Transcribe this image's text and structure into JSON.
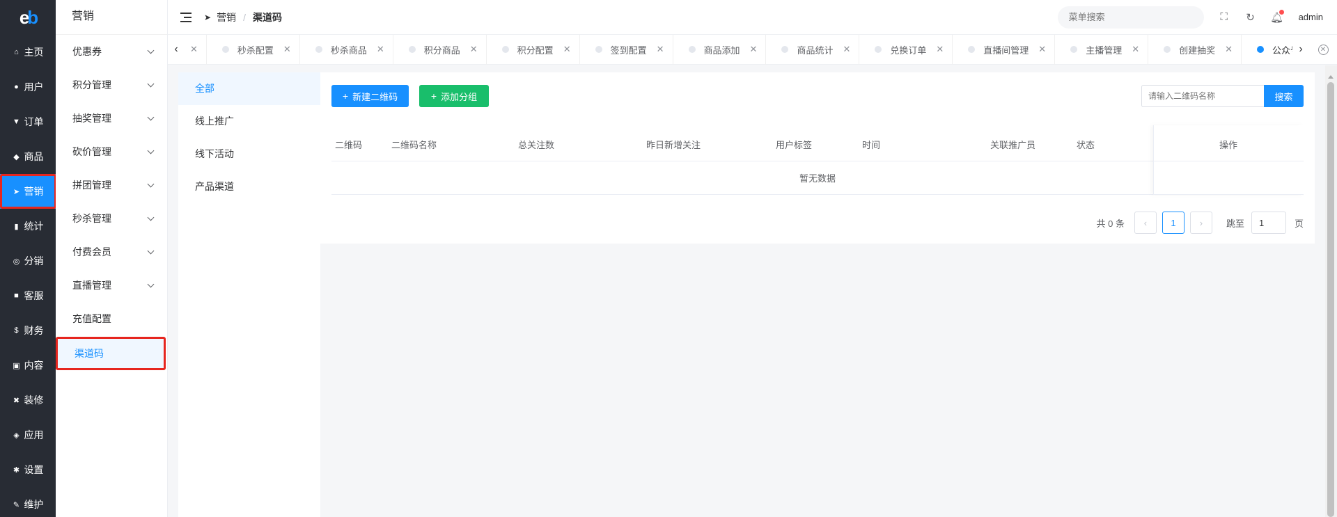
{
  "rail": {
    "logo_e": "e",
    "logo_b": "b",
    "items": [
      {
        "icon": "⌂",
        "label": "主页",
        "icon_name": "home-icon"
      },
      {
        "icon": "●",
        "label": "用户",
        "icon_name": "user-icon"
      },
      {
        "icon": "▼",
        "label": "订单",
        "icon_name": "cart-icon"
      },
      {
        "icon": "◆",
        "label": "商品",
        "icon_name": "basket-icon"
      },
      {
        "icon": "➤",
        "label": "营销",
        "icon_name": "send-icon"
      },
      {
        "icon": "▮",
        "label": "统计",
        "icon_name": "bar-chart-icon"
      },
      {
        "icon": "◎",
        "label": "分销",
        "icon_name": "handshake-icon"
      },
      {
        "icon": "■",
        "label": "客服",
        "icon_name": "chat-icon"
      },
      {
        "icon": "$",
        "label": "财务",
        "icon_name": "dollar-icon"
      },
      {
        "icon": "▣",
        "label": "内容",
        "icon_name": "book-icon"
      },
      {
        "icon": "✖",
        "label": "装修",
        "icon_name": "tools-icon"
      },
      {
        "icon": "◈",
        "label": "应用",
        "icon_name": "cube-icon"
      },
      {
        "icon": "✱",
        "label": "设置",
        "icon_name": "gear-icon"
      },
      {
        "icon": "✎",
        "label": "维护",
        "icon_name": "hammer-icon"
      }
    ],
    "active_index": 4
  },
  "submenu": {
    "title": "营销",
    "items": [
      {
        "label": "优惠券",
        "has_children": true
      },
      {
        "label": "积分管理",
        "has_children": true
      },
      {
        "label": "抽奖管理",
        "has_children": true
      },
      {
        "label": "砍价管理",
        "has_children": true
      },
      {
        "label": "拼团管理",
        "has_children": true
      },
      {
        "label": "秒杀管理",
        "has_children": true
      },
      {
        "label": "付费会员",
        "has_children": true
      },
      {
        "label": "直播管理",
        "has_children": true
      },
      {
        "label": "充值配置",
        "has_children": false
      },
      {
        "label": "渠道码",
        "has_children": false
      }
    ],
    "active_index": 9
  },
  "header": {
    "breadcrumb_parent": "营销",
    "breadcrumb_sep": "/",
    "breadcrumb_current": "渠道码",
    "menu_search_placeholder": "菜单搜索",
    "user": "admin"
  },
  "tabs": {
    "items": [
      {
        "label": "",
        "partial": true
      },
      {
        "label": "秒杀配置"
      },
      {
        "label": "秒杀商品"
      },
      {
        "label": "积分商品"
      },
      {
        "label": "积分配置"
      },
      {
        "label": "签到配置"
      },
      {
        "label": "商品添加"
      },
      {
        "label": "商品统计"
      },
      {
        "label": "兑换订单"
      },
      {
        "label": "直播间管理"
      },
      {
        "label": "主播管理"
      },
      {
        "label": "创建抽奖"
      },
      {
        "label": "公众号渠道码",
        "active": true
      }
    ]
  },
  "groups": {
    "items": [
      "全部",
      "线上推广",
      "线下活动",
      "产品渠道"
    ],
    "active_index": 0
  },
  "toolbar": {
    "new_label": "新建二维码",
    "add_group_label": "添加分组",
    "search_placeholder": "请输入二维码名称",
    "search_button": "搜索"
  },
  "table": {
    "columns": [
      "二维码",
      "二维码名称",
      "总关注数",
      "昨日新增关注",
      "用户标签",
      "时间",
      "关联推广员",
      "状态"
    ],
    "op_column": "操作",
    "empty_text": "暂无数据"
  },
  "pager": {
    "total_text": "共 0 条",
    "current_page": "1",
    "jump_label": "跳至",
    "jump_value": "1",
    "page_suffix": "页"
  },
  "colors": {
    "primary": "#1890ff",
    "success": "#19be6b",
    "highlight_border": "#e6261f",
    "rail_bg": "#282c34"
  }
}
